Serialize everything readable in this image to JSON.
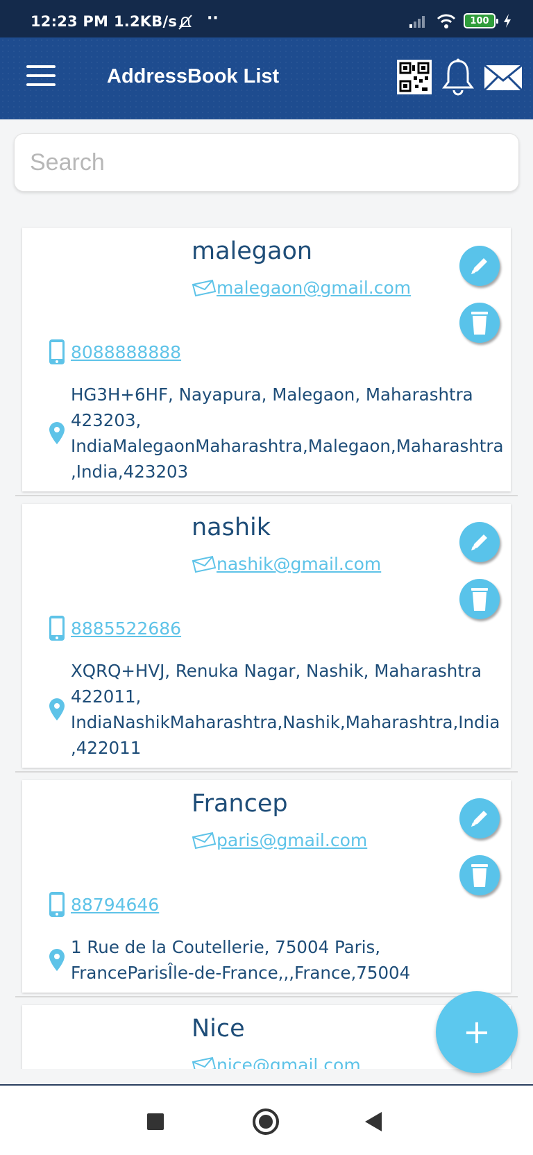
{
  "status_bar": {
    "time": "12:23 PM",
    "speed": "1.2KB/s",
    "more": "··",
    "battery": "100"
  },
  "toolbar": {
    "title": "AddressBook List"
  },
  "search": {
    "placeholder": "Search",
    "value": ""
  },
  "contacts": [
    {
      "name": "malegaon",
      "email": "malegaon@gmail.com",
      "phone": "8088888888",
      "address": "HG3H+6HF, Nayapura, Malegaon, Maharashtra\n423203,\nIndiaMalegaonMaharashtra,Malegaon,Maharashtra\n,India,423203"
    },
    {
      "name": "nashik",
      "email": "nashik@gmail.com",
      "phone": "8885522686",
      "address": "XQRQ+HVJ, Renuka Nagar, Nashik, Maharashtra\n422011,\nIndiaNashikMaharashtra,Nashik,Maharashtra,India\n,422011"
    },
    {
      "name": "Francep",
      "email": "paris@gmail.com",
      "phone": "88794646",
      "address": "1 Rue de la Coutellerie, 75004 Paris,\nFranceParisÎle-de-France,,,France,75004"
    },
    {
      "name": "Nice",
      "email": "nice@gmail.com",
      "phone": "",
      "address": ""
    }
  ],
  "fab": {
    "label": "+"
  },
  "colors": {
    "header": "#1e4c8f",
    "statusbar": "#142a4b",
    "accent": "#5cc8ee",
    "text": "#1e4d78"
  }
}
